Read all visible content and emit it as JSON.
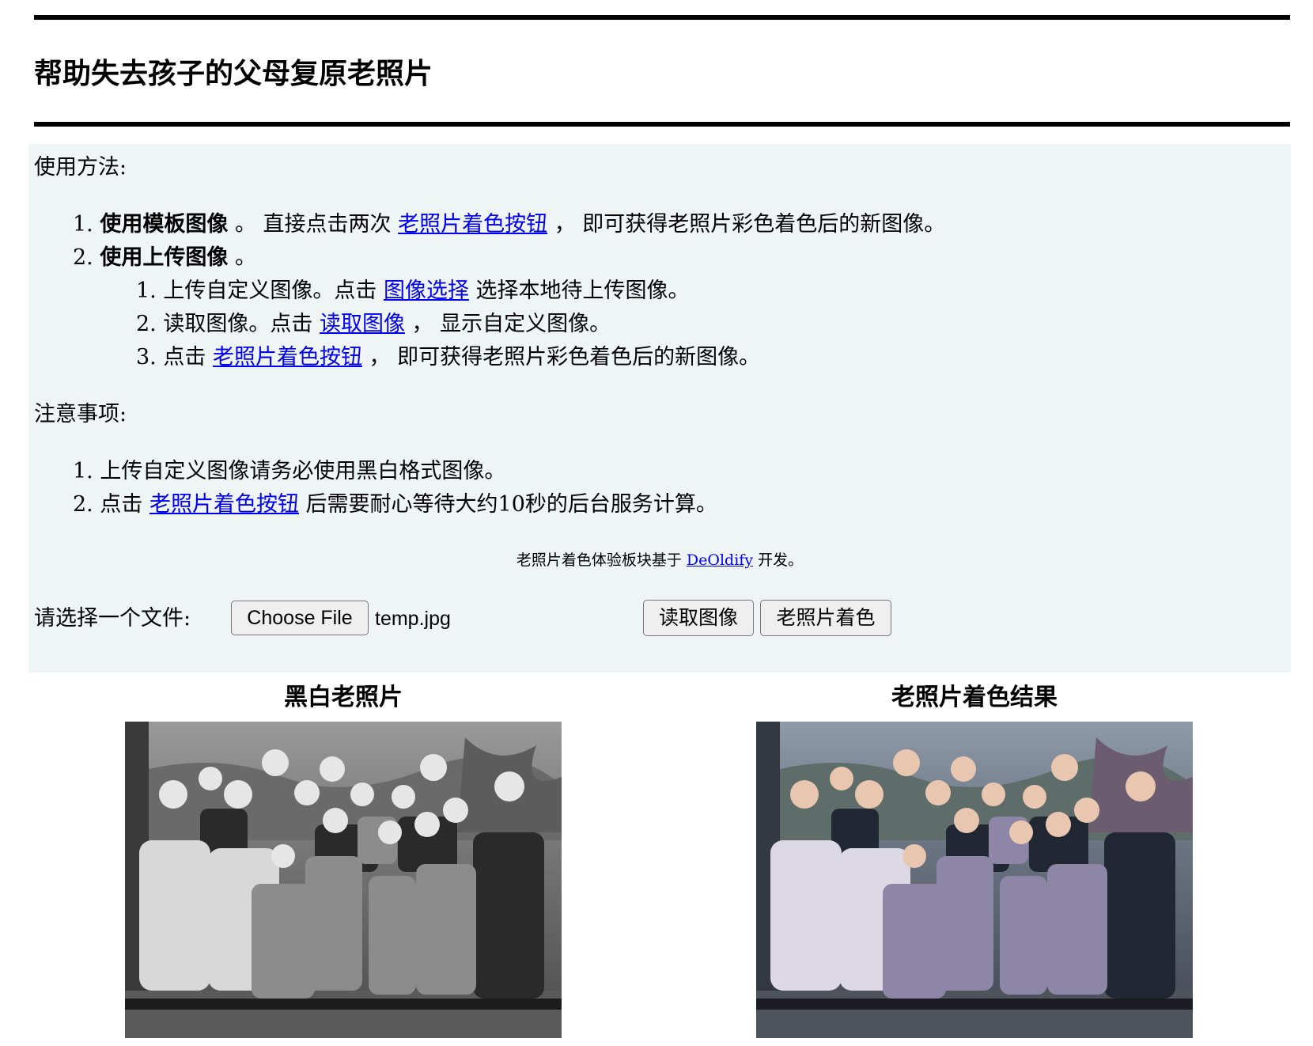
{
  "header": {
    "title": "帮助失去孩子的父母复原老照片"
  },
  "usage": {
    "title": "使用方法:",
    "steps": [
      {
        "num": "1.",
        "bold": "使用模板图像",
        "after_bold": " 。 直接点击两次 ",
        "link": "老照片着色按钮",
        "tail": " ， 即可获得老照片彩色着色后的新图像。"
      },
      {
        "num": "2.",
        "bold": "使用上传图像",
        "after_bold": " 。",
        "substeps": [
          {
            "num": "1.",
            "pre": "上传自定义图像。点击 ",
            "link": "图像选择",
            "tail": " 选择本地待上传图像。"
          },
          {
            "num": "2.",
            "pre": "读取图像。点击 ",
            "link": "读取图像",
            "tail": " ， 显示自定义图像。"
          },
          {
            "num": "3.",
            "pre": "点击 ",
            "link": "老照片着色按钮",
            "tail": " ， 即可获得老照片彩色着色后的新图像。"
          }
        ]
      }
    ]
  },
  "notes": {
    "title": "注意事项:",
    "items": [
      {
        "num": "1.",
        "pre": "上传自定义图像请务必使用黑白格式图像。",
        "link": "",
        "tail": ""
      },
      {
        "num": "2.",
        "pre": "点击 ",
        "link": "老照片着色按钮",
        "tail": " 后需要耐心等待大约10秒的后台服务计算。"
      }
    ]
  },
  "credit": {
    "pre": "老照片着色体验板块基于 ",
    "link": "DeOldify",
    "tail": " 开发。"
  },
  "file_picker": {
    "label": "请选择一个文件:",
    "choose_label": "Choose File",
    "file_name": "temp.jpg"
  },
  "buttons": {
    "read_label": "读取图像",
    "colorize_label": "老照片着色"
  },
  "images": {
    "left_title": "黑白老照片",
    "right_title": "老照片着色结果"
  },
  "colors": {
    "panel_bg": "#eff4f4",
    "link": "#0000ee"
  }
}
